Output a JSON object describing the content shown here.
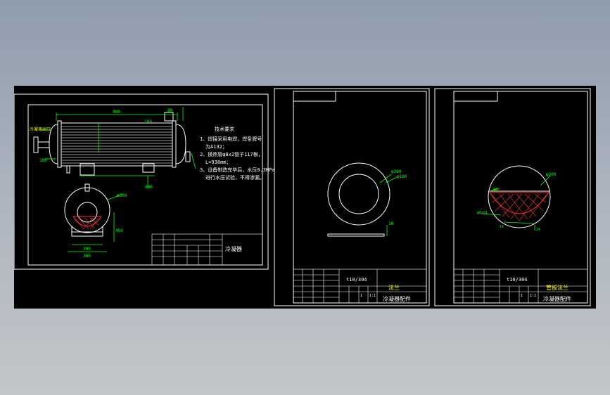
{
  "colors": {
    "background_top": "#8f9cad",
    "canvas": "#000000",
    "frame": "#ffffff",
    "dimension": "#00ff00",
    "hidden_line": "#ff3333",
    "tube": "#cccccc",
    "annotation": "#ffff00"
  },
  "sheet1": {
    "notes_title": "技术要求",
    "notes": [
      "1、焊接采用电焊，焊条牌号",
      "为A132；",
      "2、换热管φ8x2管子117根，",
      "L=938mm；",
      "3、设备制造完毕后，水压0.3MPa",
      "进行水压试验，不得渗漏。"
    ],
    "left_label": "冷凝液出口",
    "dims": {
      "overall": "980",
      "flange_top": "80",
      "flange_left": "100",
      "support_span": "600",
      "support_right": "100",
      "shell_dia": "φ300",
      "height": "450",
      "base_width": "300",
      "base_total": "360"
    },
    "title_block_name": "冷凝器"
  },
  "sheet2": {
    "dim_label": "φ300",
    "dim_label2": "φ180",
    "thickness": "10",
    "material": "t10/304",
    "part_name": "法兰",
    "drawing_name": "冷凝器配件",
    "scale": "1:1",
    "sheet_no": "1"
  },
  "sheet3": {
    "dim_label": "φ300",
    "angle": "30°",
    "hole_label": "φ8x81",
    "dim_small": "16",
    "dim_small2": "24",
    "material": "t10/304",
    "part_name": "管板法兰",
    "drawing_name": "冷凝器配件",
    "scale": "1:1",
    "sheet_no": "1"
  }
}
